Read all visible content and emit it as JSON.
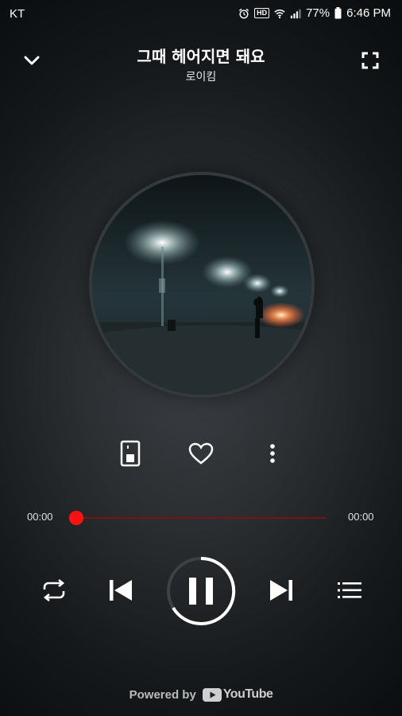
{
  "status": {
    "carrier": "KT",
    "hd": "HD",
    "battery": "77%",
    "time": "6:46 PM",
    "icons": [
      "alarm-icon",
      "hd-icon",
      "wifi-icon",
      "signal-icon",
      "battery-icon"
    ]
  },
  "header": {
    "title": "그때 헤어지면 돼요",
    "artist": "로이킴",
    "collapse_icon": "chevron-down-icon",
    "fullscreen_icon": "fullscreen-icon"
  },
  "actions": {
    "items": [
      "pip-icon",
      "heart-icon",
      "more-vertical-icon"
    ]
  },
  "progress": {
    "current": "00:00",
    "total": "00:00",
    "fraction": 0,
    "accent": "#ff1111"
  },
  "controls": {
    "items": [
      "repeat-icon",
      "previous-icon",
      "pause-icon",
      "next-icon",
      "playlist-icon"
    ]
  },
  "footer": {
    "powered_by": "Powered by",
    "brand": "YouTube"
  }
}
